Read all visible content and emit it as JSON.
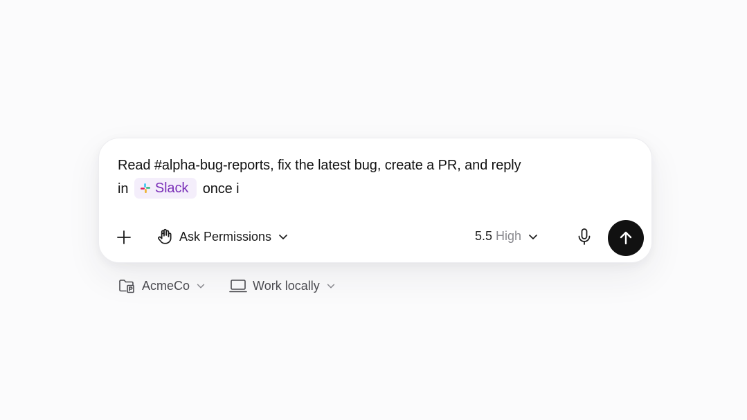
{
  "composer": {
    "prompt_line1": "Read #alpha-bug-reports, fix the latest bug, create a PR, and reply",
    "prompt_line2_before": "in",
    "mention_label": "Slack",
    "prompt_line2_after": "once i"
  },
  "toolbar": {
    "permissions_label": "Ask Permissions",
    "model_version": "5.5",
    "model_level": "High"
  },
  "below": {
    "org_label": "AcmeCo",
    "workspace_label": "Work locally"
  },
  "icons": {
    "add": "plus-icon",
    "permissions": "hand-icon",
    "mic": "microphone-icon",
    "send": "arrow-up-icon",
    "org": "folder-icon",
    "workspace": "laptop-icon",
    "mention": "slack-icon"
  },
  "colors": {
    "mention_bg": "#f4eefb",
    "mention_text": "#7a2fb8",
    "send_bg": "#111111",
    "muted_text": "#8a8a8f"
  }
}
